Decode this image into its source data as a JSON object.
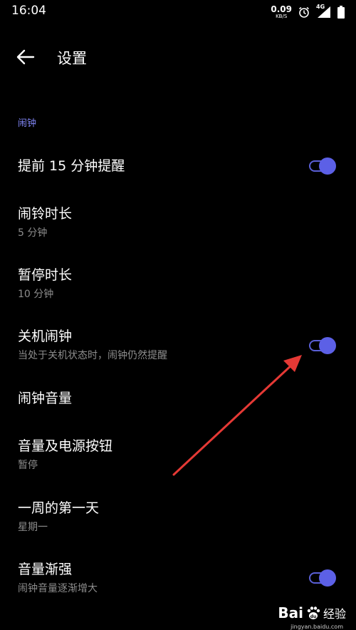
{
  "status_bar": {
    "time": "16:04",
    "net_speed": "0.09",
    "net_unit": "KB/S",
    "network_type": "4G",
    "icons": [
      "alarm-icon",
      "signal-icon",
      "battery-icon"
    ]
  },
  "header": {
    "back_icon": "arrow-left-icon",
    "title": "设置"
  },
  "section": {
    "label": "闹钟"
  },
  "settings": [
    {
      "title": "提前 15 分钟提醒",
      "subtitle": "",
      "toggle": true,
      "toggle_on": true
    },
    {
      "title": "闹铃时长",
      "subtitle": "5 分钟",
      "toggle": false
    },
    {
      "title": "暂停时长",
      "subtitle": "10 分钟",
      "toggle": false
    },
    {
      "title": "关机闹钟",
      "subtitle": "当处于关机状态时，闹钟仍然提醒",
      "toggle": true,
      "toggle_on": true
    },
    {
      "title": "闹钟音量",
      "subtitle": "",
      "toggle": false
    },
    {
      "title": "音量及电源按钮",
      "subtitle": "暂停",
      "toggle": false
    },
    {
      "title": "一周的第一天",
      "subtitle": "星期一",
      "toggle": false
    },
    {
      "title": "音量渐强",
      "subtitle": "闹钟音量逐渐增大",
      "toggle": true,
      "toggle_on": true
    }
  ],
  "watermark": {
    "logo": "Bai",
    "logo_suffix": "du",
    "text": "经验",
    "url": "jingyan.baidu.com"
  },
  "colors": {
    "accent": "#5c60e6",
    "section_header": "#7f84f2",
    "annotation_arrow": "#e53935"
  }
}
